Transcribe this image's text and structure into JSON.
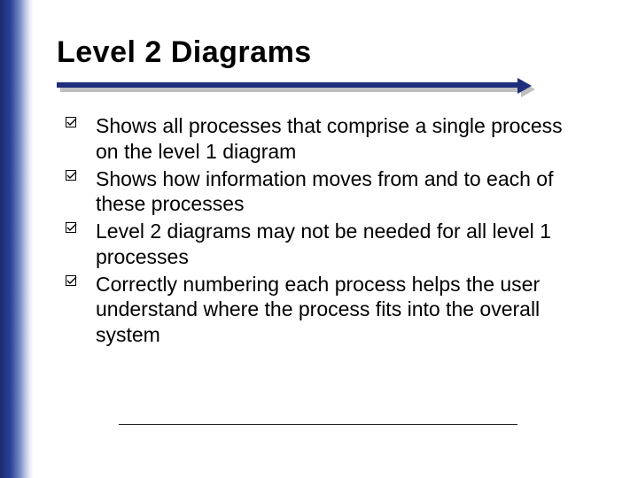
{
  "title": "Level 2 Diagrams",
  "bullets": [
    {
      "text": "Shows all processes that comprise a single process on the level 1 diagram"
    },
    {
      "text": "Shows how information moves from and to each of these processes"
    },
    {
      "text": "Level 2 diagrams may not be needed for all level 1 processes"
    },
    {
      "text": "Correctly numbering each process helps the user understand where the process fits into the overall system"
    }
  ]
}
